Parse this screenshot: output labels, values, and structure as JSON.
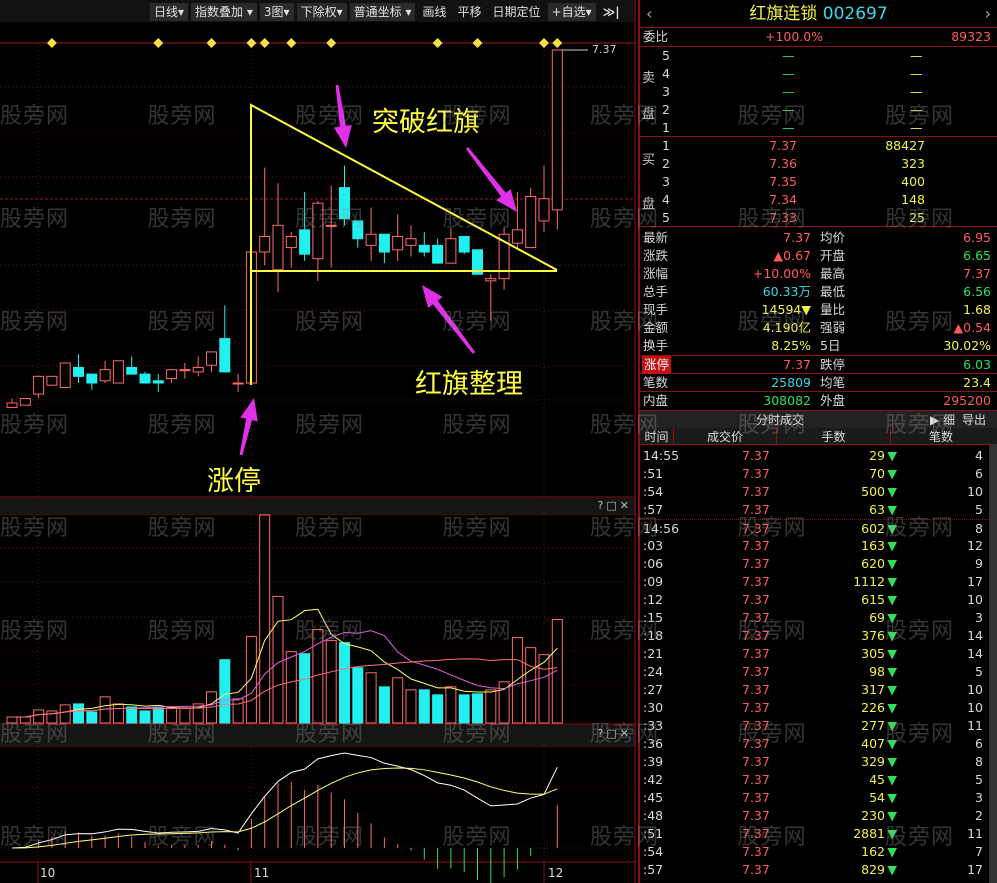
{
  "toolbar": {
    "items": [
      "日线",
      "指数叠加",
      "3图",
      "下除权",
      "普通坐标",
      "画线",
      "平移",
      "日期定位",
      "+自选"
    ],
    "end_icon": "skip-to-end-icon"
  },
  "watermark": "股旁网",
  "annotations": {
    "breakout": "突破红旗",
    "consolidation": "红旗整理",
    "limit_up": "涨停"
  },
  "price_label": "7.37",
  "x_axis": [
    "10",
    "11",
    "12"
  ],
  "event_marker_bars": [
    3,
    11,
    15,
    18,
    19,
    21,
    24,
    32,
    35,
    40,
    41
  ],
  "chart_data": {
    "type": "candlestick",
    "candles": [
      [
        5.76,
        5.8,
        5.76,
        5.78
      ],
      [
        5.77,
        5.8,
        5.77,
        5.8
      ],
      [
        5.82,
        5.9,
        5.8,
        5.9
      ],
      [
        5.86,
        5.9,
        5.86,
        5.9
      ],
      [
        5.85,
        5.96,
        5.85,
        5.96
      ],
      [
        5.94,
        6.0,
        5.87,
        5.9
      ],
      [
        5.91,
        5.91,
        5.84,
        5.87
      ],
      [
        5.88,
        5.97,
        5.87,
        5.93
      ],
      [
        5.87,
        5.97,
        5.87,
        5.97
      ],
      [
        5.94,
        5.99,
        5.91,
        5.91
      ],
      [
        5.91,
        5.92,
        5.87,
        5.87
      ],
      [
        5.88,
        5.91,
        5.83,
        5.87
      ],
      [
        5.89,
        5.93,
        5.87,
        5.93
      ],
      [
        5.93,
        5.96,
        5.89,
        5.93
      ],
      [
        5.92,
        5.99,
        5.9,
        5.94
      ],
      [
        5.95,
        6.01,
        5.92,
        6.01
      ],
      [
        6.07,
        6.22,
        5.92,
        5.92
      ],
      [
        5.87,
        5.91,
        5.83,
        5.87
      ],
      [
        5.87,
        6.46,
        5.87,
        6.46
      ],
      [
        6.46,
        6.84,
        6.4,
        6.53
      ],
      [
        6.38,
        6.77,
        6.28,
        6.58
      ],
      [
        6.48,
        6.55,
        6.39,
        6.53
      ],
      [
        6.56,
        6.73,
        6.42,
        6.45
      ],
      [
        6.43,
        6.69,
        6.33,
        6.68
      ],
      [
        6.58,
        6.76,
        6.39,
        6.58
      ],
      [
        6.75,
        6.85,
        6.58,
        6.61
      ],
      [
        6.6,
        6.6,
        6.48,
        6.52
      ],
      [
        6.49,
        6.66,
        6.42,
        6.54
      ],
      [
        6.54,
        6.54,
        6.41,
        6.46
      ],
      [
        6.47,
        6.63,
        6.42,
        6.53
      ],
      [
        6.49,
        6.58,
        6.44,
        6.52
      ],
      [
        6.49,
        6.55,
        6.44,
        6.46
      ],
      [
        6.49,
        6.52,
        6.41,
        6.41
      ],
      [
        6.41,
        6.57,
        6.41,
        6.52
      ],
      [
        6.53,
        6.53,
        6.45,
        6.46
      ],
      [
        6.47,
        6.47,
        6.36,
        6.36
      ],
      [
        6.33,
        6.36,
        6.15,
        6.34
      ],
      [
        6.34,
        6.57,
        6.29,
        6.54
      ],
      [
        6.5,
        6.73,
        6.48,
        6.56
      ],
      [
        6.48,
        6.75,
        6.48,
        6.71
      ],
      [
        6.6,
        6.85,
        6.55,
        6.7
      ],
      [
        6.65,
        7.37,
        6.56,
        7.37
      ]
    ],
    "candle_fields": [
      "open",
      "high",
      "low",
      "close"
    ],
    "volume": [
      6,
      6,
      13,
      12,
      18,
      19,
      11,
      26,
      19,
      16,
      12,
      15,
      15,
      15,
      19,
      31,
      63,
      24,
      86,
      207,
      126,
      71,
      69,
      93,
      82,
      80,
      55,
      50,
      36,
      45,
      33,
      33,
      28,
      36,
      28,
      29,
      33,
      41,
      85,
      75,
      68,
      103
    ],
    "volume_ylim": [
      0,
      207
    ],
    "price_ylim": [
      5.72,
      7.5
    ],
    "volume_ma": [
      5,
      10,
      20
    ],
    "indicator": "MACD(12,26,9)"
  },
  "quote": {
    "name": "红旗连锁",
    "code": "002697",
    "weibi_label": "委比",
    "weibi": "+100.0%",
    "weicha": "89323",
    "sell_label": [
      "卖",
      "盘"
    ],
    "buy_label": [
      "买",
      "盘"
    ],
    "sells": [
      {
        "n": "5",
        "p": "—",
        "v": "—"
      },
      {
        "n": "4",
        "p": "—",
        "v": "—"
      },
      {
        "n": "3",
        "p": "—",
        "v": "—"
      },
      {
        "n": "2",
        "p": "—",
        "v": "—"
      },
      {
        "n": "1",
        "p": "—",
        "v": "—"
      }
    ],
    "buys": [
      {
        "n": "1",
        "p": "7.37",
        "v": "88427"
      },
      {
        "n": "2",
        "p": "7.36",
        "v": "323"
      },
      {
        "n": "3",
        "p": "7.35",
        "v": "400"
      },
      {
        "n": "4",
        "p": "7.34",
        "v": "148"
      },
      {
        "n": "5",
        "p": "7.33",
        "v": "25"
      }
    ],
    "stats": [
      {
        "l1": "最新",
        "v1": "7.37",
        "c1": "r",
        "l2": "均价",
        "v2": "6.95",
        "c2": "r"
      },
      {
        "l1": "涨跌",
        "v1": "▲0.67",
        "c1": "r",
        "l2": "开盘",
        "v2": "6.65",
        "c2": "g"
      },
      {
        "l1": "涨幅",
        "v1": "+10.00%",
        "c1": "r",
        "l2": "最高",
        "v2": "7.37",
        "c2": "r"
      },
      {
        "l1": "总手",
        "v1": "60.33万",
        "c1": "c",
        "l2": "最低",
        "v2": "6.56",
        "c2": "g"
      },
      {
        "l1": "现手",
        "v1": "14594▼",
        "c1": "y",
        "l2": "量比",
        "v2": "1.68",
        "c2": "y"
      },
      {
        "l1": "金额",
        "v1": "4.190亿",
        "c1": "y",
        "l2": "强弱",
        "v2": "▲0.54",
        "c2": "r"
      },
      {
        "l1": "换手",
        "v1": "8.25%",
        "c1": "y",
        "l2": "5日",
        "v2": "30.02%",
        "c2": "y"
      }
    ],
    "limit": {
      "l1": "涨停",
      "v1": "7.37",
      "l2": "跌停",
      "v2": "6.03"
    },
    "bishu": {
      "l1": "笔数",
      "v1": "25809",
      "l2": "均笔",
      "v2": "23.4"
    },
    "pan": {
      "l1": "内盘",
      "v1": "308082",
      "l2": "外盘",
      "v2": "295200"
    }
  },
  "ticks": {
    "title": "分时成交",
    "detail": "细",
    "export": "导出",
    "columns": [
      "时间",
      "成交价",
      "手数",
      "笔数"
    ],
    "rows": [
      [
        "14:55",
        "7.37",
        "29",
        "4"
      ],
      [
        ":51",
        "7.37",
        "70",
        "6"
      ],
      [
        ":54",
        "7.37",
        "500",
        "10"
      ],
      [
        ":57",
        "7.37",
        "63",
        "5"
      ],
      [
        "14:56",
        "7.37",
        "602",
        "8"
      ],
      [
        ":03",
        "7.37",
        "163",
        "12"
      ],
      [
        ":06",
        "7.37",
        "620",
        "9"
      ],
      [
        ":09",
        "7.37",
        "1112",
        "17"
      ],
      [
        ":12",
        "7.37",
        "615",
        "10"
      ],
      [
        ":15",
        "7.37",
        "69",
        "3"
      ],
      [
        ":18",
        "7.37",
        "376",
        "14"
      ],
      [
        ":21",
        "7.37",
        "305",
        "14"
      ],
      [
        ":24",
        "7.37",
        "98",
        "5"
      ],
      [
        ":27",
        "7.37",
        "317",
        "10"
      ],
      [
        ":30",
        "7.37",
        "226",
        "10"
      ],
      [
        ":33",
        "7.37",
        "277",
        "11"
      ],
      [
        ":36",
        "7.37",
        "407",
        "6"
      ],
      [
        ":39",
        "7.37",
        "329",
        "8"
      ],
      [
        ":42",
        "7.37",
        "45",
        "5"
      ],
      [
        ":45",
        "7.37",
        "54",
        "3"
      ],
      [
        ":48",
        "7.37",
        "230",
        "2"
      ],
      [
        ":51",
        "7.37",
        "2881",
        "11"
      ],
      [
        ":54",
        "7.37",
        "162",
        "7"
      ],
      [
        ":57",
        "7.37",
        "829",
        "17"
      ]
    ]
  },
  "colors": {
    "up": "#ff6a6a",
    "down": "#22f0f0",
    "frame": "#8b1010",
    "annot": "#ffff40",
    "arrow": "#e030e8"
  }
}
